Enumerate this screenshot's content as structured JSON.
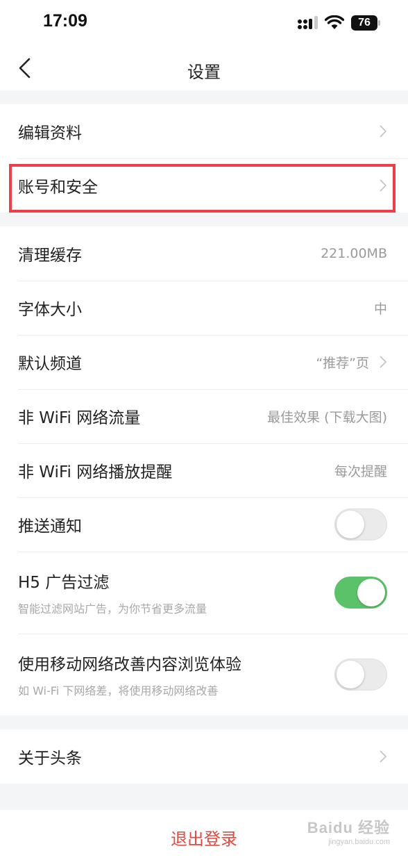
{
  "status_bar": {
    "time": "17:09",
    "battery": "76"
  },
  "nav": {
    "title": "设置"
  },
  "group1": [
    {
      "label": "编辑资料"
    },
    {
      "label": "账号和安全"
    }
  ],
  "group2": {
    "clear_cache": {
      "label": "清理缓存",
      "value": "221.00MB"
    },
    "font_size": {
      "label": "字体大小",
      "value": "中"
    },
    "default_channel": {
      "label": "默认频道",
      "value": "“推荐”页"
    },
    "non_wifi_traffic": {
      "label": "非 WiFi 网络流量",
      "value": "最佳效果 (下载大图)"
    },
    "non_wifi_play": {
      "label": "非 WiFi 网络播放提醒",
      "value": "每次提醒"
    },
    "push": {
      "label": "推送通知",
      "enabled": false
    },
    "h5_filter": {
      "label": "H5 广告过滤",
      "sub": "智能过滤网站广告，为你节省更多流量",
      "enabled": true
    },
    "mobile_boost": {
      "label": "使用移动网络改善内容浏览体验",
      "sub": "如 Wi-Fi 下网络差，将使用移动网络改善",
      "enabled": false
    }
  },
  "group3": {
    "about": {
      "label": "关于头条"
    }
  },
  "logout": {
    "label": "退出登录"
  },
  "watermark": {
    "main": "Baidu 经验",
    "sub": "jingyan.baidu.com"
  },
  "colors": {
    "highlight": "#ee3f48",
    "toggle_on": "#5cc26a",
    "logout": "#e2483f"
  }
}
